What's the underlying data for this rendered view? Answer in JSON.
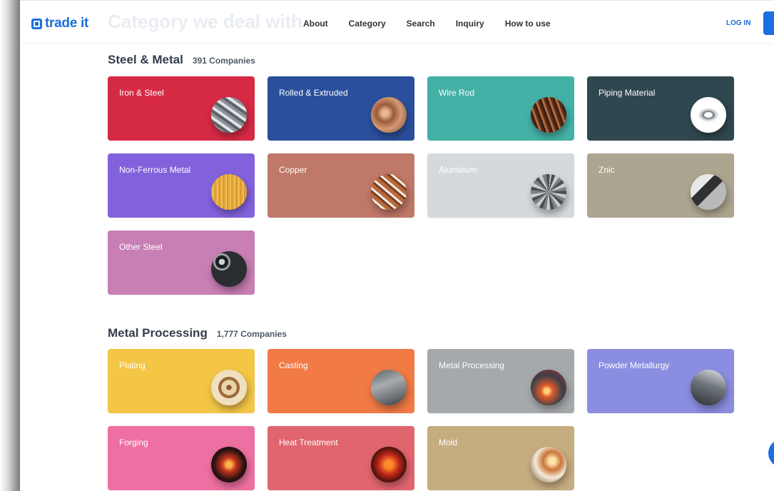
{
  "header": {
    "logo_text": "trade it",
    "ghost_title": "Category we deal with",
    "nav": [
      "About",
      "Category",
      "Search",
      "Inquiry",
      "How to use"
    ],
    "login": "LOG IN"
  },
  "colors": {
    "accent": "#1b6fe0",
    "text_dark": "#333d4b"
  },
  "sections": [
    {
      "name": "Steel & Metal",
      "count": "391 Companies",
      "cards": [
        {
          "label": "Iron & Steel",
          "color": "#d62a45",
          "icon": "steel-pipes-photo"
        },
        {
          "label": "Rolled & Extruded",
          "color": "#2a4f9c",
          "icon": "copper-rolls-photo"
        },
        {
          "label": "Wire Rod",
          "color": "#44b1a7",
          "icon": "wire-coil-photo"
        },
        {
          "label": "Piping Material",
          "color": "#2f474f",
          "icon": "pipe-fitting-photo"
        },
        {
          "label": "Non-Ferrous Metal",
          "color": "#8262dc",
          "icon": "brushed-gold-photo"
        },
        {
          "label": "Copper",
          "color": "#c07868",
          "icon": "copper-tubes-photo"
        },
        {
          "label": "Aluminum",
          "color": "#d6d9dc",
          "icon": "aluminum-foil-photo"
        },
        {
          "label": "Znic",
          "color": "#aca58f",
          "icon": "zinc-sheet-photo"
        },
        {
          "label": "Other Steel",
          "color": "#c87fb4",
          "icon": "steel-rods-photo"
        }
      ]
    },
    {
      "name": "Metal Processing",
      "count": "1,777 Companies",
      "cards": [
        {
          "label": "Plating",
          "color": "#f3c646",
          "icon": "plated-parts-photo"
        },
        {
          "label": "Casting",
          "color": "#f17a45",
          "icon": "casting-factory-photo"
        },
        {
          "label": "Metal Processing",
          "color": "#a6a9ac",
          "icon": "grinding-sparks-photo"
        },
        {
          "label": "Powder Metallurgy",
          "color": "#8b8ee0",
          "icon": "machine-photo"
        },
        {
          "label": "Forging",
          "color": "#ee6fa1",
          "icon": "forge-fire-photo"
        },
        {
          "label": "Heat Treatment",
          "color": "#e0656e",
          "icon": "heat-glow-photo"
        },
        {
          "label": "Mold",
          "color": "#c6ad80",
          "icon": "mold-tool-photo"
        }
      ]
    }
  ]
}
